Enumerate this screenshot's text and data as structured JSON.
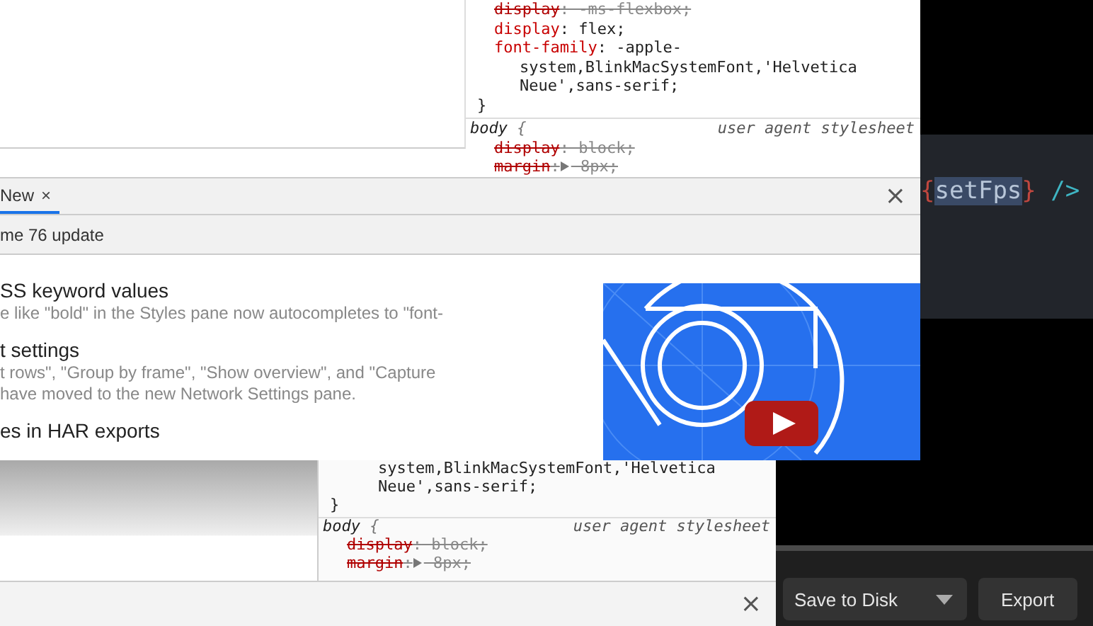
{
  "top_devtools": {
    "styles": {
      "lines": [
        {
          "kind": "decl",
          "property": "display",
          "colon": ":",
          "value": "-ms-flexbox;",
          "overridden": true
        },
        {
          "kind": "decl",
          "property": "display",
          "colon": ":",
          "value": "flex;",
          "overridden": false
        },
        {
          "kind": "decl",
          "property": "font-family",
          "colon": ":",
          "value": "-apple-",
          "overridden": false
        },
        {
          "kind": "cont",
          "text": "system,BlinkMacSystemFont,'Helvetica"
        },
        {
          "kind": "cont",
          "text": "Neue',sans-serif;"
        },
        {
          "kind": "brace",
          "text": "}"
        }
      ],
      "rule": {
        "selector": "body",
        "brace": "{",
        "origin": "user agent stylesheet",
        "lines": [
          {
            "kind": "decl",
            "property": "display",
            "colon": ":",
            "value": "block;",
            "overridden": true
          },
          {
            "kind": "shorthand",
            "property": "margin",
            "colon": ":",
            "value": "8px;",
            "overridden": true
          }
        ]
      }
    }
  },
  "drawer": {
    "tabs": [
      {
        "label": "New",
        "close": "×",
        "selected": true
      }
    ],
    "close": "×",
    "subtitle": "me 76 update",
    "items": [
      {
        "title": "SS keyword values",
        "description": [
          "e like \"bold\" in the Styles pane now autocompletes to \"font-"
        ]
      },
      {
        "title": "t settings",
        "description": [
          "t rows\", \"Group by frame\", \"Show overview\", and \"Capture",
          "have moved to the new Network Settings pane."
        ]
      },
      {
        "title": "es in HAR exports"
      }
    ]
  },
  "editor": {
    "tokens": [
      {
        "text": "{",
        "kind": "brace",
        "selected": false
      },
      {
        "text": "setFps",
        "kind": "identifier",
        "selected": true
      },
      {
        "text": "}",
        "kind": "brace",
        "selected": false
      },
      {
        "text": "/>",
        "kind": "tag",
        "selected": false
      }
    ]
  },
  "bottom_devtools": {
    "styles": {
      "lines": [
        {
          "kind": "cont",
          "text": "system,BlinkMacSystemFont,'Helvetica"
        },
        {
          "kind": "cont",
          "text": "Neue',sans-serif;"
        },
        {
          "kind": "brace",
          "text": "}"
        }
      ],
      "rule": {
        "selector": "body",
        "brace": "{",
        "origin": "user agent stylesheet",
        "lines": [
          {
            "kind": "decl",
            "property": "display",
            "colon": ":",
            "value": "block;",
            "overridden": true
          },
          {
            "kind": "shorthand",
            "property": "margin",
            "colon": ":",
            "value": "8px;",
            "overridden": true
          }
        ]
      }
    },
    "close": "×"
  },
  "export_bar": {
    "buttons": [
      {
        "label": "Save to Disk",
        "kind": "dropdown"
      },
      {
        "label": "Export",
        "kind": "plain"
      }
    ]
  }
}
